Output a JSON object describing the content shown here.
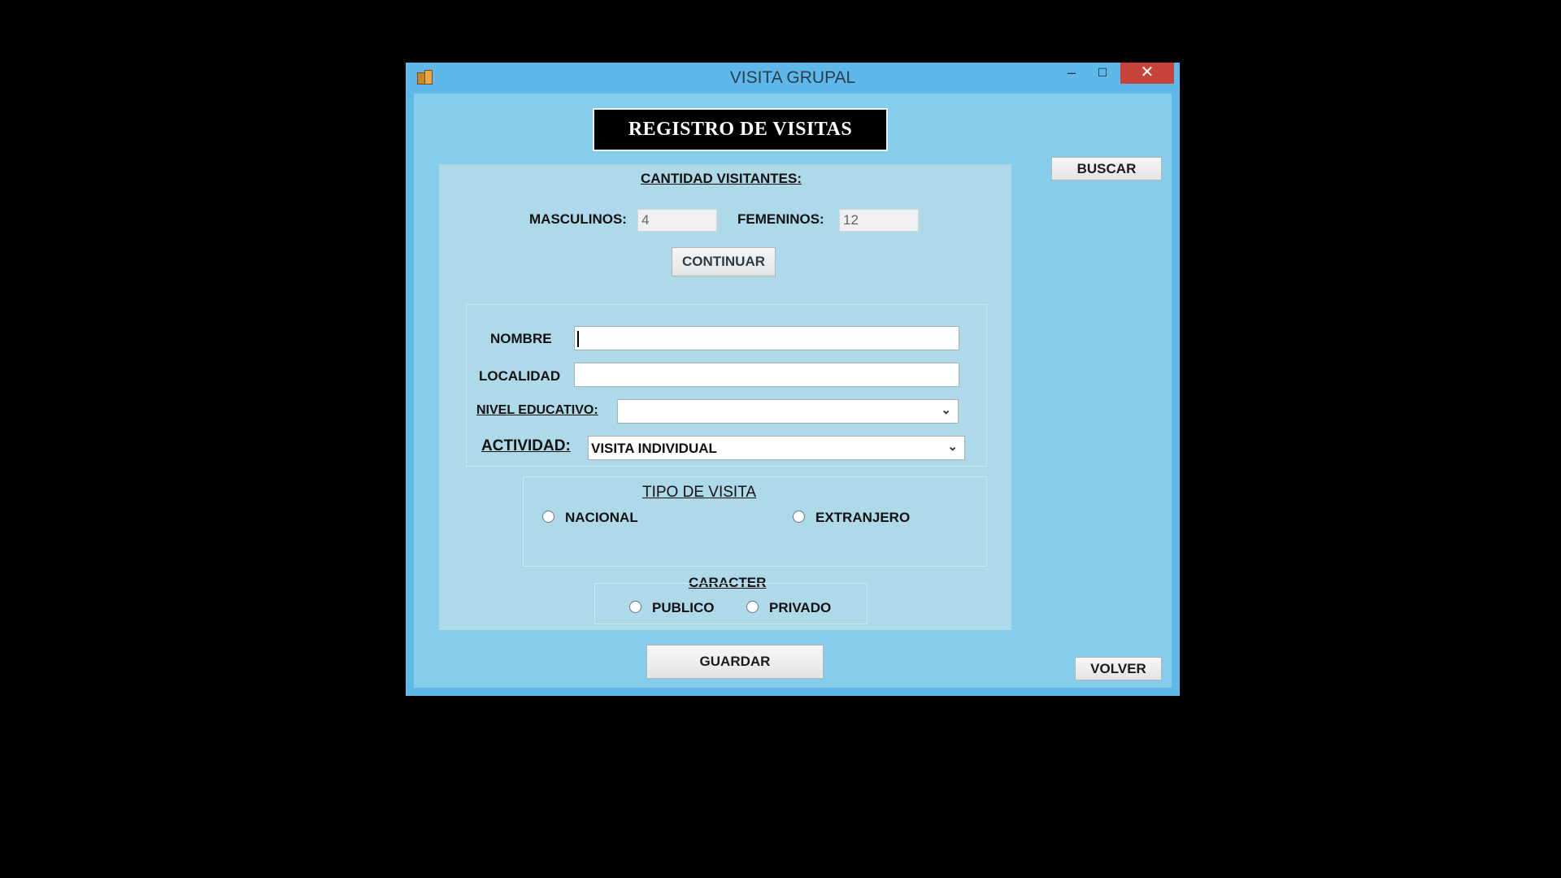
{
  "window": {
    "title": "VISITA GRUPAL",
    "controls": {
      "minimize": "–",
      "maximize": "☐",
      "close": "✕"
    },
    "accent_color": "#5fb8ea",
    "close_color": "#c7423a"
  },
  "header": {
    "title": "REGISTRO DE VISITAS"
  },
  "buttons": {
    "buscar": "BUSCAR",
    "continuar": "CONTINUAR",
    "guardar": "GUARDAR",
    "volver": "VOLVER"
  },
  "visitors": {
    "heading": "CANTIDAD VISITANTES:",
    "male_label": "MASCULINOS:",
    "male_value": "4",
    "female_label": "FEMENINOS:",
    "female_value": "12"
  },
  "form": {
    "nombre_label": "NOMBRE",
    "nombre_value": "",
    "localidad_label": "LOCALIDAD",
    "localidad_value": "",
    "nivel_label": "NIVEL EDUCATIVO:",
    "nivel_value": "",
    "actividad_label": "ACTIVIDAD:",
    "actividad_value": "VISITA INDIVIDUAL"
  },
  "tipo_visita": {
    "heading": "TIPO DE VISITA",
    "option1": "NACIONAL",
    "option2": "EXTRANJERO"
  },
  "caracter": {
    "heading": "CARACTER",
    "option1": "PUBLICO",
    "option2": "PRIVADO"
  }
}
